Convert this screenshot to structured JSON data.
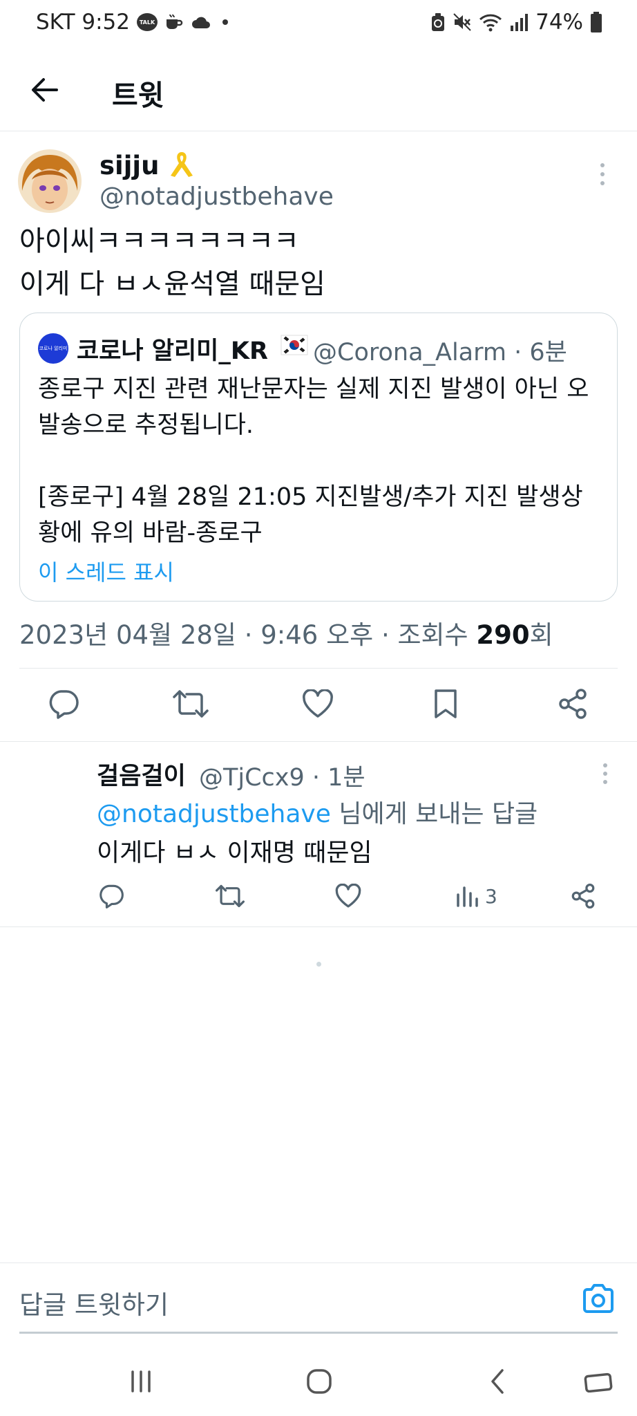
{
  "status_bar": {
    "carrier_time": "SKT 9:52",
    "talk_badge": "TALK",
    "battery": "74%"
  },
  "header": {
    "title": "트윗"
  },
  "tweet": {
    "author_name": "sijju",
    "author_handle": "@notadjustbehave",
    "text": "아이씨ㅋㅋㅋㅋㅋㅋㅋㅋ\n이게 다 ㅂㅅ윤석열 때문임",
    "quote": {
      "name": "코로나 알리미_KR",
      "handle_time": "@Corona_Alarm · 6분",
      "avatar_text": "코로나 알리미",
      "text": "종로구 지진 관련 재난문자는 실제 지진 발생이 아닌 오발송으로 추정됩니다.\n\n[종로구] 4월 28일 21:05 지진발생/추가 지진 발생상황에 유의 바람-종로구",
      "show_thread": "이 스레드 표시"
    },
    "meta_prefix": "2023년 04월 28일 · 9:46 오후 · 조회수 ",
    "views": "290",
    "meta_suffix": "회"
  },
  "reply": {
    "name": "걸음걸이",
    "handle_time": "@TjCcx9 · 1분",
    "mention": "@notadjustbehave",
    "reply_to_suffix": " 님에게 보내는 답글",
    "text": "이게다 ㅂㅅ 이재명 때문임",
    "views": "3"
  },
  "reply_bar": {
    "placeholder": "답글 트윗하기"
  },
  "colors": {
    "accent": "#1d9bf0",
    "secondary_text": "#536471",
    "ribbon": "#f5c518"
  }
}
